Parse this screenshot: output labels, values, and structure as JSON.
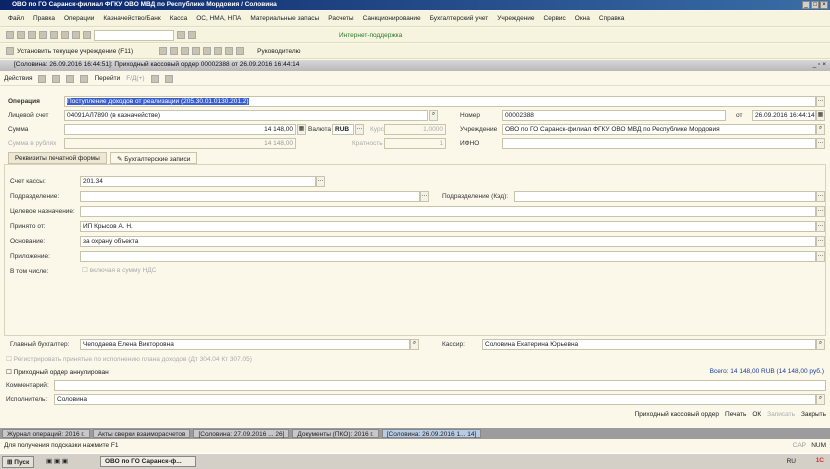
{
  "window": {
    "title": "ОВО по ГО Саранск-филиал ФГКУ ОВО МВД по Республике Мордовия / Соловина"
  },
  "menu": [
    "Файл",
    "Правка",
    "Операции",
    "Казначейство/Банк",
    "Касса",
    "ОС, НМА, НПА",
    "Материальные запасы",
    "Расчеты",
    "Санкционирование",
    "Бухгалтерский учет",
    "Учреждение",
    "Сервис",
    "Окна",
    "Справка"
  ],
  "toolbar": {
    "set_institution": "Установить текущее учреждение (F11)",
    "support": "Интернет-поддержка",
    "manager": "Руководителю"
  },
  "document": {
    "title": "[Соловина: 26.09.2016 16:44:51]: Приходный кассовый ордер 00002388 от 26.09.2016 16:44:14",
    "actions": "Действия",
    "go": "Перейти",
    "fmt": "F/Д(+)"
  },
  "form": {
    "operation_label": "Операция",
    "operation": "Поступление доходов от реализации (205.30.01.0130.201.2)",
    "account_label": "Лицевой счет",
    "account": "04091АЛ7890 (в казначействе)",
    "sum_label": "Сумма",
    "sum": "14 148,00",
    "currency_label": "Валюта",
    "currency": "RUB",
    "rate_label": "Курс",
    "rate": "1,0000",
    "sum_rub_label": "Сумма в рублях",
    "sum_rub": "14 148,00",
    "multiplicity_label": "Кратность",
    "multiplicity": "1",
    "number_label": "Номер",
    "number": "00002388",
    "date_from": "от",
    "date": "26.09.2016 16:44:14",
    "institution_label": "Учреждение",
    "institution": "ОВО по ГО Саранск-филиал ФГКУ ОВО МВД по Республике Мордовия",
    "ifno_label": "ИФНО",
    "ifno": ""
  },
  "tabs": [
    "Реквизиты печатной формы",
    "Бухгалтерские записи"
  ],
  "print": {
    "cash_account_label": "Счет кассы:",
    "cash_account": "201.34",
    "subdivision_label": "Подразделение:",
    "subdivision_kbd_label": "Подразделение (Кэд):",
    "purpose_label": "Целевое назначение:",
    "received_from_label": "Принято от:",
    "received_from": "ИП Крысов А. Н.",
    "basis_label": "Основание:",
    "basis": "за охрану объекта",
    "attachment_label": "Приложение:",
    "including_label": "В том числе:",
    "vat_checkbox": "включая в сумму НДС"
  },
  "signers": {
    "chief_label": "Главный бухгалтер:",
    "chief": "Чеподаева Елена Викторовна",
    "cashier_label": "Кассир:",
    "cashier": "Соловина Екатерина Юрьевна"
  },
  "bottom": {
    "check_text": "Регистрировать принятые по исполнению плана доходов (Дт 304.04 Кт 307.05)",
    "annulled": "Приходный ордер аннулирован",
    "total": "Всего: 14 148,00 RUB (14 148,00 руб.)",
    "comment_label": "Комментарий:",
    "comment": "",
    "executor_label": "Исполнитель:",
    "executor": "Соловина"
  },
  "buttons": {
    "pko": "Приходный кассовый ордер",
    "print": "Печать",
    "ok": "ОК",
    "write": "Записать",
    "close": "Закрыть"
  },
  "open_windows": [
    "Журнал операций: 2016 г.",
    "Акты сверки взаиморасчетов",
    "[Соловина: 27.09.2016 ... 26]",
    "Документы (ПКО): 2016 г.",
    "[Соловина: 26.09.2016 1... 14]"
  ],
  "status": {
    "hint": "Для получения подсказки нажмите F1",
    "cap": "CAP",
    "num": "NUM"
  },
  "taskbar": {
    "start": "Пуск",
    "app": "ОВО по ГО Саранск-ф...",
    "lang": "RU"
  }
}
